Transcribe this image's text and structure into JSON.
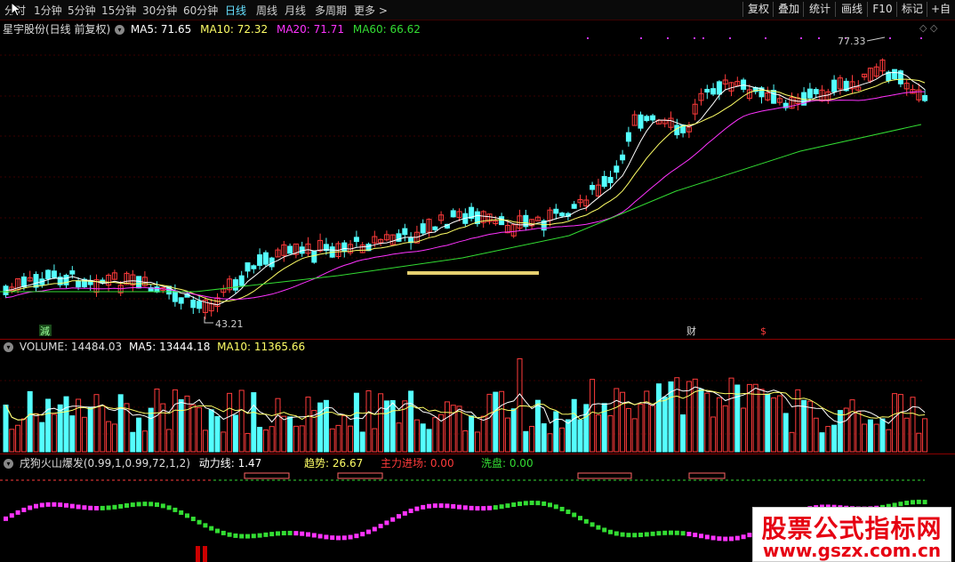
{
  "toolbar": {
    "timeframes": [
      "分时",
      "1分钟",
      "5分钟",
      "15分钟",
      "30分钟",
      "60分钟",
      "日线",
      "周线",
      "月线",
      "多周期",
      "更多 >"
    ],
    "active_index": 6,
    "right_buttons": [
      "复权",
      "叠加",
      "统计",
      "画线",
      "F10",
      "标记",
      "+自"
    ]
  },
  "main_pane": {
    "stock": "星宇股份(日线 前复权)",
    "ma5": "MA5: 71.65",
    "ma10": "MA10: 72.32",
    "ma20": "MA20: 71.71",
    "ma60": "MA60: 66.62",
    "high_label": "77.33",
    "low_label": "43.21",
    "marker_jian": "減",
    "marker_cai": "财",
    "marker_dollar": "$"
  },
  "volume_pane": {
    "volume": "VOLUME: 14484.03",
    "ma5": "MA5: 13444.18",
    "ma10": "MA10: 11365.66"
  },
  "indicator_pane": {
    "name": "戌狗火山爆发",
    "params": "(0.99,1,0.99,72,1,2)",
    "power": "动力线: 1.47",
    "trend": "趋势: 26.67",
    "main_entry": "主力进场: 0.00",
    "wash": "洗盘: 0.00"
  },
  "watermark": {
    "line1": "股票公式指标网",
    "line2": "www.gszx.com.cn"
  },
  "colors": {
    "up": "#ff3b3b",
    "down": "#54ffff",
    "ma5": "#ffffff",
    "ma10": "#ffff66",
    "ma20": "#ff33ff",
    "ma60": "#33dd33",
    "border": "#8b0000"
  }
}
